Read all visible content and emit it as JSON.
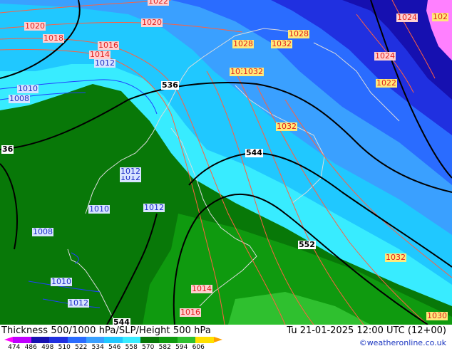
{
  "title": "Thickness 500/1000 hPa/SLP/Height 500 hPa",
  "run_time": "Tu 21-01-2025 12:00 UTC (12+00)",
  "credit": "©weatheronline.co.uk",
  "colors": {
    "green_dark": "#087808",
    "green_mid": "#0f9a0f",
    "green_light": "#2fc02f",
    "cyan": "#38ecff",
    "sky": "#20c8ff",
    "blue_light": "#3aa0ff",
    "blue_mid": "#2a6cff",
    "blue_dark": "#2030e0",
    "navy": "#1610b0",
    "magenta": "#ff80ff"
  },
  "scale": {
    "ticks": [
      "474",
      "486",
      "498",
      "510",
      "522",
      "534",
      "546",
      "558",
      "570",
      "582",
      "594",
      "606"
    ],
    "colors": [
      "#ff00ff",
      "#c000ff",
      "#1610b0",
      "#2030e0",
      "#2a6cff",
      "#3aa0ff",
      "#20c8ff",
      "#38ecff",
      "#087808",
      "#0f9a0f",
      "#2fc02f",
      "#ffe000",
      "#ffa000"
    ]
  },
  "labels": {
    "isobars_red": [
      "1022",
      "1020",
      "1020",
      "1018",
      "1016",
      "1014",
      "1024",
      "1024",
      "1014",
      "1016",
      "1030"
    ],
    "isobars_blue": [
      "1012",
      "1010",
      "1008",
      "1010",
      "1012",
      "1010",
      "1008",
      "1010",
      "1012"
    ],
    "isobars_green": [
      "1012",
      "1012"
    ],
    "isobars_yellow": [
      "1028",
      "1032",
      "1032",
      "1032",
      "1022",
      "1032",
      "1028",
      "1032",
      "102"
    ],
    "heights": [
      "536",
      "544",
      "552",
      "544",
      "36"
    ]
  }
}
